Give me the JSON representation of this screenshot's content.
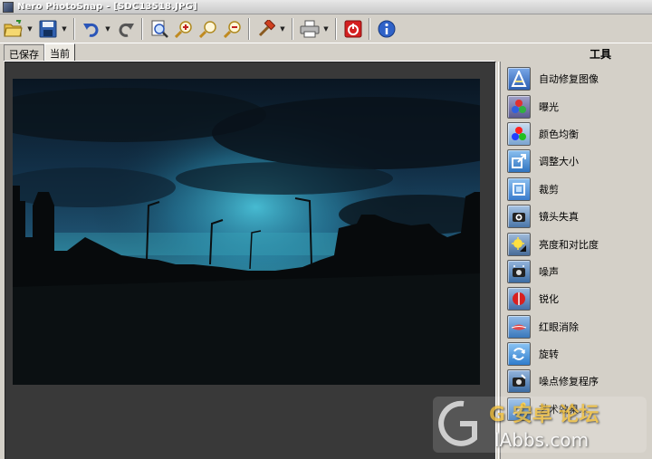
{
  "window": {
    "title": "Nero PhotoSnap - [SDC13518.JPG]"
  },
  "toolbar": {
    "buttons": [
      {
        "name": "open-icon",
        "has_dropdown": true
      },
      {
        "name": "save-icon",
        "has_dropdown": true
      },
      {
        "name": "undo-icon",
        "has_dropdown": true
      },
      {
        "name": "redo-icon",
        "has_dropdown": false
      },
      {
        "name": "fit-to-window-icon",
        "has_dropdown": false
      },
      {
        "name": "zoom-in-icon",
        "has_dropdown": false
      },
      {
        "name": "zoom-actual-icon",
        "has_dropdown": false
      },
      {
        "name": "zoom-out-icon",
        "has_dropdown": false
      },
      {
        "name": "tools-hammer-icon",
        "has_dropdown": true
      },
      {
        "name": "print-icon",
        "has_dropdown": true
      },
      {
        "name": "exit-icon",
        "has_dropdown": false
      },
      {
        "name": "info-icon",
        "has_dropdown": false
      }
    ]
  },
  "tabs": [
    {
      "label": "已保存",
      "active": false
    },
    {
      "label": "当前",
      "active": true
    }
  ],
  "tools_panel": {
    "title": "工具",
    "items": [
      {
        "label": "自动修复图像",
        "icon": "auto-fix-icon",
        "color": "#3a6fc4"
      },
      {
        "label": "曝光",
        "icon": "exposure-icon",
        "color": "#7a7ab0"
      },
      {
        "label": "颜色均衡",
        "icon": "color-balance-icon",
        "color": "#6aa0d8"
      },
      {
        "label": "调整大小",
        "icon": "resize-icon",
        "color": "#3f8ad0"
      },
      {
        "label": "裁剪",
        "icon": "crop-icon",
        "color": "#4d8fd6"
      },
      {
        "label": "镜头失真",
        "icon": "lens-distortion-icon",
        "color": "#5e86b8"
      },
      {
        "label": "亮度和对比度",
        "icon": "brightness-contrast-icon",
        "color": "#5c7fa8"
      },
      {
        "label": "噪声",
        "icon": "noise-icon",
        "color": "#4f7cb0"
      },
      {
        "label": "锐化",
        "icon": "sharpen-icon",
        "color": "#5a7fb6"
      },
      {
        "label": "红眼消除",
        "icon": "red-eye-icon",
        "color": "#4c86c8"
      },
      {
        "label": "旋转",
        "icon": "rotate-icon",
        "color": "#3e86d0"
      },
      {
        "label": "噪点修复程序",
        "icon": "noise-fix-icon",
        "color": "#4d7cb4"
      },
      {
        "label": "艺术效果...",
        "icon": "artistic-effects-icon",
        "color": "#4a7fc0"
      }
    ]
  },
  "watermark": {
    "line1": "G 安卓 论坛",
    "line2": "lAbbs.com"
  }
}
